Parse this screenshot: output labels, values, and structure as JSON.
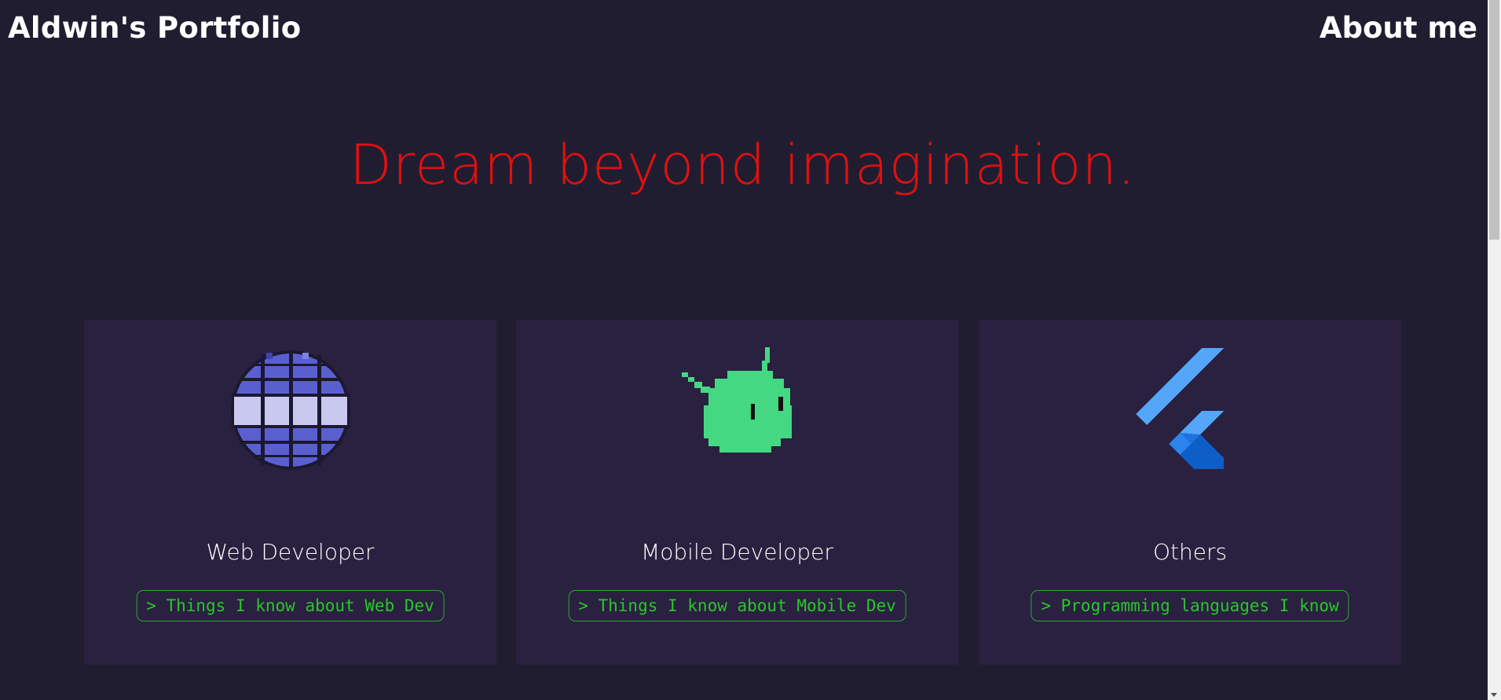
{
  "header": {
    "brand": "Aldwin's Portfolio",
    "nav_about": "About me"
  },
  "hero": {
    "tagline": "Dream beyond imagination."
  },
  "colors": {
    "background": "#211d31",
    "card": "#29213f",
    "hero_text": "#e1100f",
    "button_text": "#2ac62c",
    "button_border": "#2aa82c",
    "globe": "#5a5fd0",
    "android": "#45d883",
    "flutter_light": "#54a6f8",
    "flutter_dark": "#0d5ec6"
  },
  "cards": [
    {
      "icon": "pixel-globe-icon",
      "title": "Web Developer",
      "button": "> Things I know about Web Dev"
    },
    {
      "icon": "pixel-android-icon",
      "title": "Mobile Developer",
      "button": "> Things I know about Mobile Dev"
    },
    {
      "icon": "pixel-flutter-icon",
      "title": "Others",
      "button": "> Programming languages I know"
    }
  ]
}
